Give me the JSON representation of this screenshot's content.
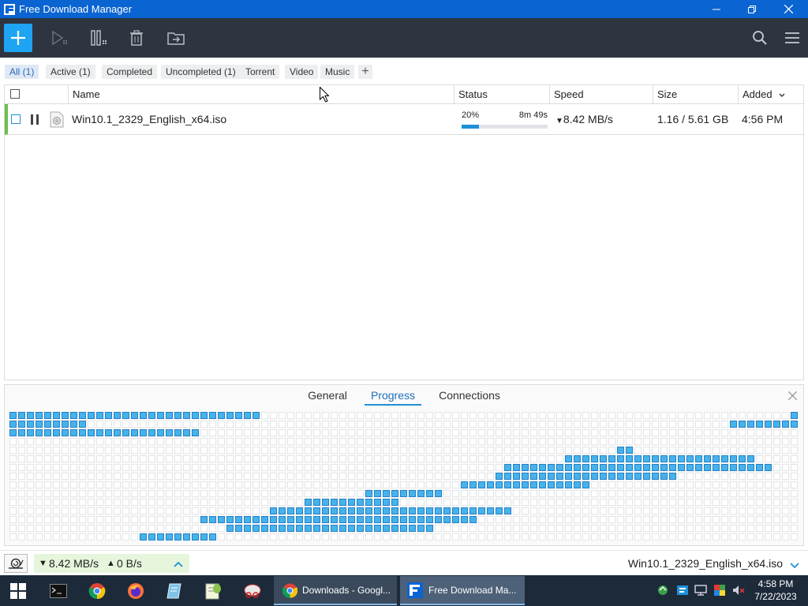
{
  "window": {
    "title": "Free Download Manager",
    "minimize": "–",
    "restore": "❐",
    "close": "✕"
  },
  "toolbar": {
    "add_label": "+"
  },
  "filter_tabs": [
    "All (1)",
    "Active (1)",
    "Completed",
    "Uncompleted (1)",
    "Torrent",
    "Video",
    "Music"
  ],
  "filter_add": "+",
  "table": {
    "headers": {
      "name": "Name",
      "status": "Status",
      "speed": "Speed",
      "size": "Size",
      "added": "Added"
    },
    "rows": [
      {
        "name": "Win10.1_2329_English_x64.iso",
        "percent_label": "20%",
        "time_left": "8m 49s",
        "progress": 0.2,
        "speed": "8.42 MB/s",
        "size": "1.16 / 5.61 GB",
        "added": "4:56 PM"
      }
    ]
  },
  "panel": {
    "tabs": [
      "General",
      "Progress",
      "Connections"
    ]
  },
  "statusbar": {
    "down": "8.42 MB/s",
    "up": "0 B/s",
    "current_file": "Win10.1_2329_English_x64.iso"
  },
  "taskbar": {
    "tasks": [
      {
        "label": "Downloads - Googl..."
      },
      {
        "label": "Free Download Ma..."
      }
    ],
    "time": "4:58 PM",
    "date": "7/22/2023"
  },
  "colors": {
    "accent": "#1ea4f2",
    "titlebar": "#0a64d2",
    "toolbar": "#2e3541",
    "block_filled": "#45b3ec",
    "active_row": "#6bc04b"
  }
}
